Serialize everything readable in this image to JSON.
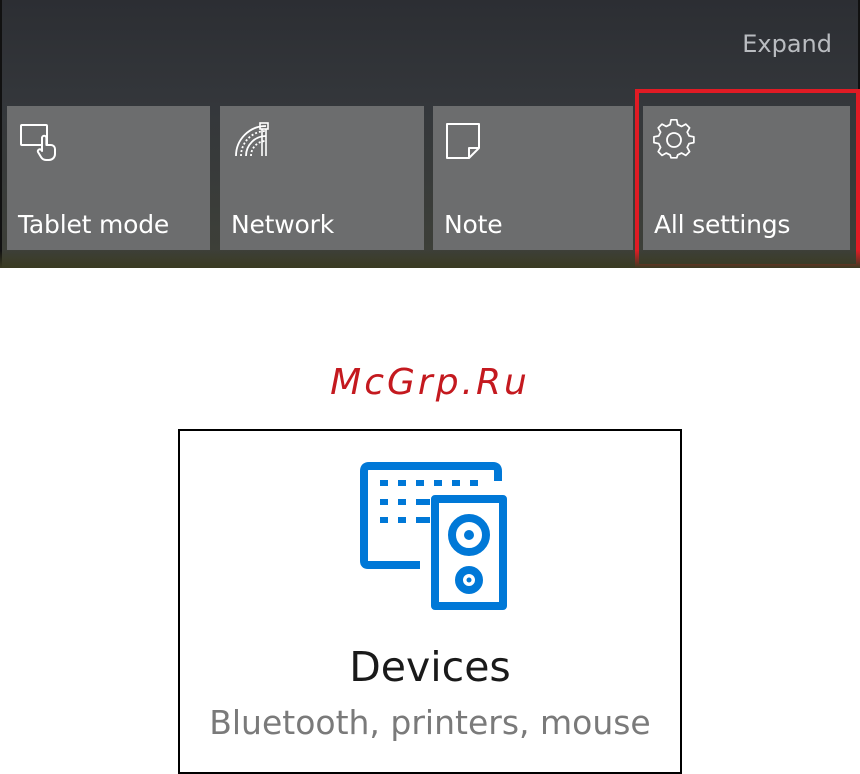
{
  "action_center": {
    "expand_label": "Expand",
    "tiles": [
      {
        "label": "Tablet mode",
        "icon": "tablet-mode-icon"
      },
      {
        "label": "Network",
        "icon": "network-icon"
      },
      {
        "label": "Note",
        "icon": "note-icon"
      },
      {
        "label": "All settings",
        "icon": "gear-icon"
      }
    ],
    "highlighted_tile": "All settings",
    "highlight_color": "#e01b24",
    "tile_color": "#6c6d6e"
  },
  "watermark": "McGrp.Ru",
  "devices_card": {
    "title": "Devices",
    "subtitle": "Bluetooth, printers, mouse",
    "icon": "devices-icon",
    "accent_color": "#0078d7"
  }
}
